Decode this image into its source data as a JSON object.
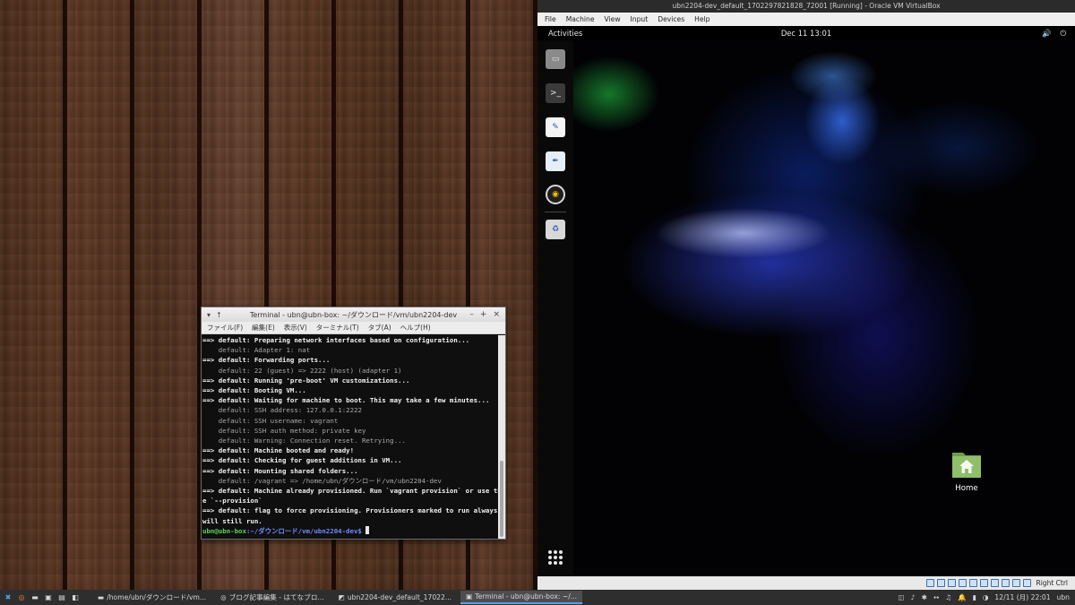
{
  "terminal": {
    "title": "Terminal - ubn@ubn-box: ~/ダウンロード/vm/ubn2204-dev",
    "titlebar_left": [
      "▾",
      "↑"
    ],
    "titlebar_right": [
      "–",
      "+",
      "×"
    ],
    "menu": [
      "ファイル(F)",
      "編集(E)",
      "表示(V)",
      "ターミナル(T)",
      "タブ(A)",
      "ヘルプ(H)"
    ],
    "lines": [
      {
        "text": "==> default: Preparing network interfaces based on configuration...",
        "style": "b"
      },
      {
        "text": "    default: Adapter 1: nat",
        "style": "g"
      },
      {
        "text": "==> default: Forwarding ports...",
        "style": "b"
      },
      {
        "text": "    default: 22 (guest) => 2222 (host) (adapter 1)",
        "style": "g"
      },
      {
        "text": "==> default: Running 'pre-boot' VM customizations...",
        "style": "b"
      },
      {
        "text": "==> default: Booting VM...",
        "style": "b"
      },
      {
        "text": "==> default: Waiting for machine to boot. This may take a few minutes...",
        "style": "b"
      },
      {
        "text": "    default: SSH address: 127.0.0.1:2222",
        "style": "g"
      },
      {
        "text": "    default: SSH username: vagrant",
        "style": "g"
      },
      {
        "text": "    default: SSH auth method: private key",
        "style": "g"
      },
      {
        "text": "    default: Warning: Connection reset. Retrying...",
        "style": "g"
      },
      {
        "text": "==> default: Machine booted and ready!",
        "style": "b"
      },
      {
        "text": "==> default: Checking for guest additions in VM...",
        "style": "b"
      },
      {
        "text": "==> default: Mounting shared folders...",
        "style": "b"
      },
      {
        "text": "    default: /vagrant => /home/ubn/ダウンロード/vm/ubn2204-dev",
        "style": "g"
      },
      {
        "text": "==> default: Machine already provisioned. Run `vagrant provision` or use th",
        "style": "b"
      },
      {
        "text": "e `--provision`",
        "style": "b"
      },
      {
        "text": "==> default: flag to force provisioning. Provisioners marked to run always",
        "style": "b"
      },
      {
        "text": "will still run.",
        "style": "b"
      }
    ],
    "prompt_user": "ubn@ubn-box",
    "prompt_path": ":~/ダウンロード/vm/ubn2204-dev$"
  },
  "vbox": {
    "title": "ubn2204-dev_default_1702297821828_72001 [Running] - Oracle VM VirtualBox",
    "menu": [
      "File",
      "Machine",
      "View",
      "Input",
      "Devices",
      "Help"
    ],
    "host_key_label": "Right Ctrl"
  },
  "guest": {
    "activities_label": "Activities",
    "clock": "Dec 11  13:01",
    "tray_icons": [
      "🔊",
      "⏻"
    ],
    "dock_apps": [
      {
        "name": "files-icon",
        "glyph": "▭",
        "color": "#8a8a8a"
      },
      {
        "name": "terminal-icon",
        "glyph": ">_",
        "color": "#3a3a3a"
      },
      {
        "name": "text-editor-icon",
        "glyph": "✎",
        "color": "#f4f4f4"
      },
      {
        "name": "text-editor-quill-icon",
        "glyph": "✒",
        "color": "#e6eef8"
      },
      {
        "name": "rhythmbox-icon",
        "glyph": "◉",
        "color": "#1e1e1e"
      },
      {
        "name": "trash-icon",
        "glyph": "♻",
        "color": "#d8d8d8"
      }
    ],
    "home_label": "Home"
  },
  "taskbar": {
    "launchers": [
      {
        "name": "xfce-menu-icon",
        "glyph": "✖"
      },
      {
        "name": "browser-icon",
        "glyph": "◎"
      },
      {
        "name": "folder-icon",
        "glyph": "▬"
      },
      {
        "name": "terminal-launcher-icon",
        "glyph": "▣"
      },
      {
        "name": "window-icon",
        "glyph": "▤"
      },
      {
        "name": "show-desktop-icon",
        "glyph": "◧"
      }
    ],
    "tasks": [
      {
        "label": "/home/ubn/ダウンロード/vm...",
        "glyph": "▬",
        "active": false
      },
      {
        "label": "ブログ記事編集 - はてなブロ...",
        "glyph": "◎",
        "active": false
      },
      {
        "label": "ubn2204-dev_default_17022...",
        "glyph": "◩",
        "active": false
      },
      {
        "label": "Terminal - ubn@ubn-box: ~/...",
        "glyph": "▣",
        "active": true
      }
    ],
    "tray": [
      "◫",
      "♪",
      "✱",
      "↔",
      "♫",
      "🔔",
      "▮",
      "◑"
    ],
    "clock": "12/11 (月) 22:01",
    "user": "ubn"
  }
}
